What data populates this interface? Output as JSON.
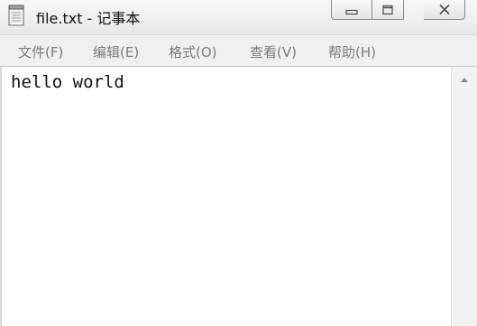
{
  "window": {
    "title": "file.txt - 记事本",
    "icon": "notepad-icon"
  },
  "window_controls": {
    "minimize_icon": "minimize-icon",
    "maximize_icon": "maximize-icon",
    "close_icon": "close-icon"
  },
  "menu": {
    "items": [
      {
        "label": "文件(F)"
      },
      {
        "label": "编辑(E)"
      },
      {
        "label": "格式(O)"
      },
      {
        "label": "查看(V)"
      },
      {
        "label": "帮助(H)"
      }
    ]
  },
  "editor": {
    "content": "hello world"
  },
  "scrollbar": {
    "up_icon": "scroll-up-arrow-icon"
  },
  "colors": {
    "menu_text": "#7a7a7a",
    "menubar_bg": "#f0f0f0",
    "editor_bg": "#ffffff"
  }
}
